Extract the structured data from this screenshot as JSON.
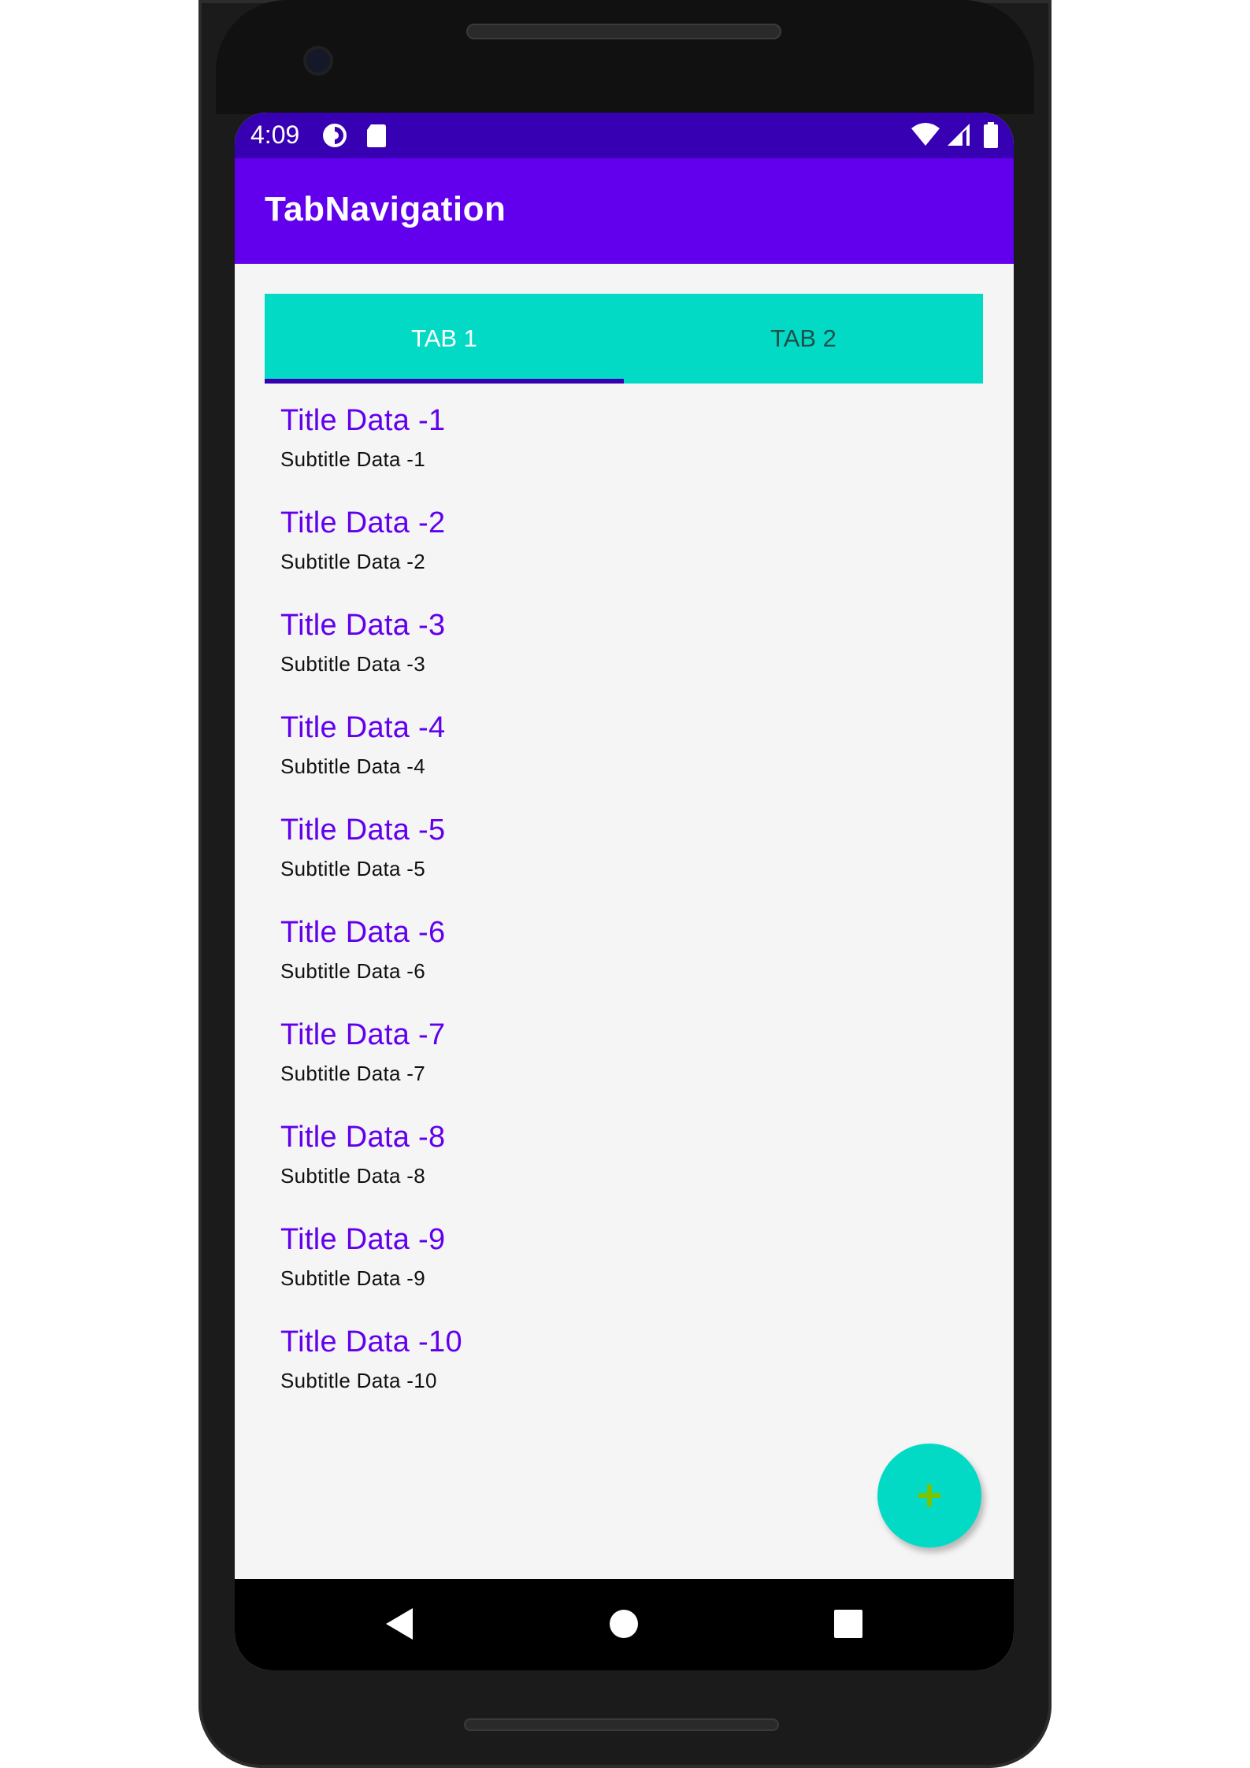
{
  "status_bar": {
    "time": "4:09",
    "icons": [
      "sync-icon",
      "sd-card-icon",
      "wifi-icon",
      "cell-signal-icon",
      "battery-icon"
    ],
    "color": "#3700b3"
  },
  "app_bar": {
    "title": "TabNavigation",
    "color": "#6200ee"
  },
  "tabs": [
    {
      "label": "TAB 1",
      "selected": true
    },
    {
      "label": "TAB 2",
      "selected": false
    }
  ],
  "tab_bar_color": "#03dac5",
  "list": {
    "items": [
      {
        "title": "Title Data -1",
        "subtitle": "Subtitle Data -1"
      },
      {
        "title": "Title Data -2",
        "subtitle": "Subtitle Data -2"
      },
      {
        "title": "Title Data -3",
        "subtitle": "Subtitle Data -3"
      },
      {
        "title": "Title Data -4",
        "subtitle": "Subtitle Data -4"
      },
      {
        "title": "Title Data -5",
        "subtitle": "Subtitle Data -5"
      },
      {
        "title": "Title Data -6",
        "subtitle": "Subtitle Data -6"
      },
      {
        "title": "Title Data -7",
        "subtitle": "Subtitle Data -7"
      },
      {
        "title": "Title Data -8",
        "subtitle": "Subtitle Data -8"
      },
      {
        "title": "Title Data -9",
        "subtitle": "Subtitle Data -9"
      },
      {
        "title": "Title Data -10",
        "subtitle": "Subtitle Data -10"
      }
    ]
  },
  "fab": {
    "icon": "plus-icon",
    "color": "#03dac5",
    "icon_color": "#7cc400"
  },
  "nav_bar": {
    "buttons": [
      "back-icon",
      "home-icon",
      "recents-icon"
    ]
  }
}
